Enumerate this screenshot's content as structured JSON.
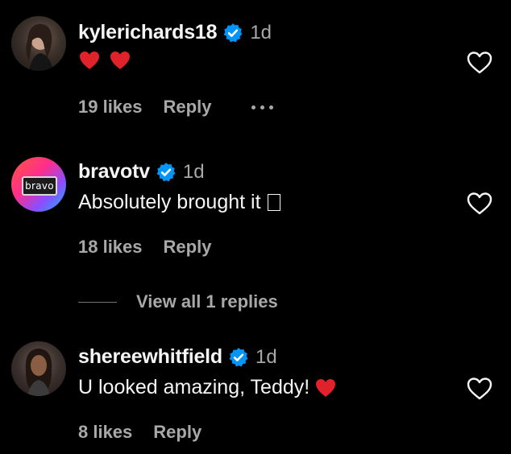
{
  "colors": {
    "background": "#000000",
    "text": "#f5f5f5",
    "muted": "#a8a8a8",
    "verified": "#0095f6",
    "heart": "#e0222b"
  },
  "comments": [
    {
      "username": "kylerichards18",
      "time": "1d",
      "text": "",
      "emoji": [
        "red-heart",
        "red-heart"
      ],
      "likes": "19 likes",
      "reply": "Reply"
    },
    {
      "username": "bravotv",
      "time": "1d",
      "text": "Absolutely brought it",
      "likes": "18 likes",
      "reply": "Reply",
      "avatar_text": "bravo"
    },
    {
      "username": "shereewhitfield",
      "time": "1d",
      "text": "U looked amazing, Teddy!",
      "emoji": [
        "red-heart"
      ],
      "likes": "8 likes",
      "reply": "Reply"
    }
  ],
  "view_replies": "View all 1 replies"
}
